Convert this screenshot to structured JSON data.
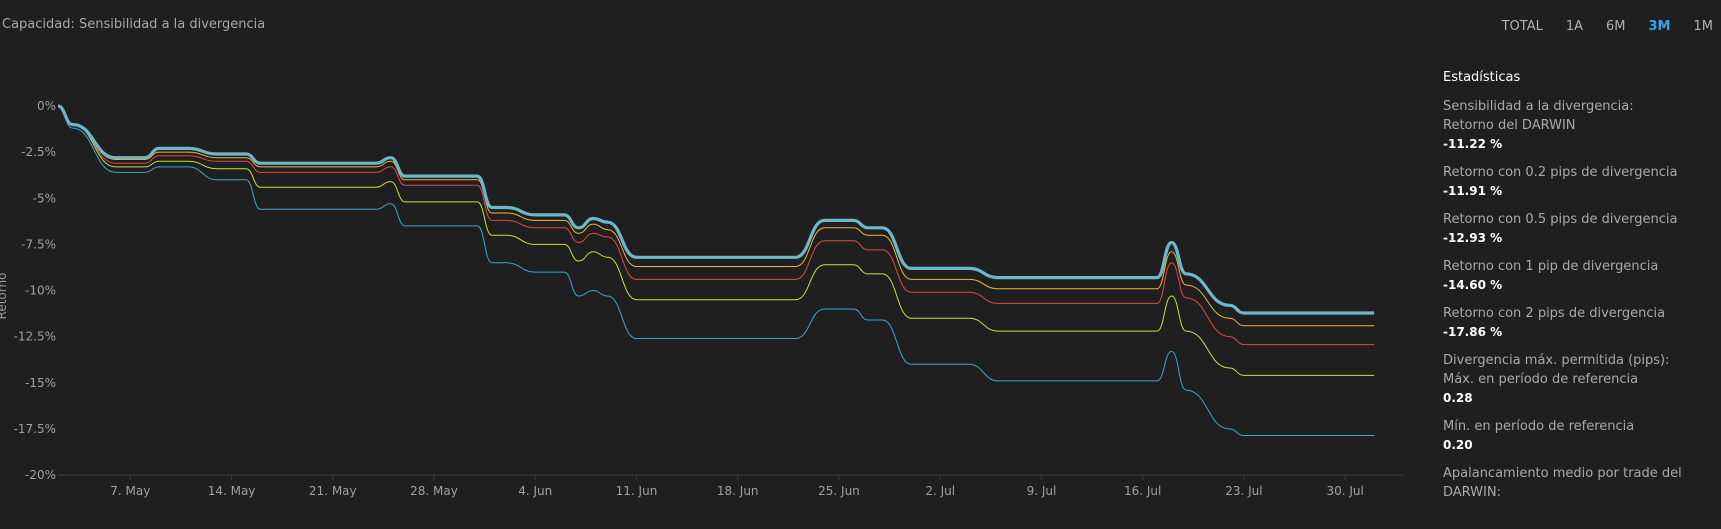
{
  "header": {
    "title": "Capacidad: Sensibilidad a la divergencia",
    "ranges": [
      "TOTAL",
      "1A",
      "6M",
      "3M",
      "1M"
    ],
    "active_range": "3M"
  },
  "stats": {
    "heading": "Estadísticas",
    "items": [
      {
        "label": "Sensibilidad a la divergencia:",
        "value": ""
      },
      {
        "label": "Retorno del DARWIN",
        "value": "-11.22 %"
      },
      {
        "label": "Retorno con 0.2 pips de divergencia",
        "value": "-11.91 %"
      },
      {
        "label": "Retorno con 0.5 pips de divergencia",
        "value": "-12.93 %"
      },
      {
        "label": "Retorno con 1 pip de divergencia",
        "value": "-14.60 %"
      },
      {
        "label": "Retorno con 2 pips de divergencia",
        "value": "-17.86 %"
      },
      {
        "label": "Divergencia máx. permitida (pips):",
        "value": ""
      },
      {
        "label": "Máx. en período de referencia",
        "value": "0.28"
      },
      {
        "label": "Mín. en período de referencia",
        "value": "0.20"
      },
      {
        "label": "Apalancamiento medio por trade del DARWIN:",
        "value": ""
      }
    ]
  },
  "chart_data": {
    "type": "line",
    "ylabel": "Retorno",
    "ylim": [
      -20,
      0
    ],
    "y_ticks": [
      {
        "value": 0,
        "label": "0%"
      },
      {
        "value": -2.5,
        "label": "-2.5%"
      },
      {
        "value": -5,
        "label": "-5%"
      },
      {
        "value": -7.5,
        "label": "-7.5%"
      },
      {
        "value": -10,
        "label": "-10%"
      },
      {
        "value": -12.5,
        "label": "-12.5%"
      },
      {
        "value": -15,
        "label": "-15%"
      },
      {
        "value": -17.5,
        "label": "-17.5%"
      },
      {
        "value": -20,
        "label": "-20%"
      }
    ],
    "x_ticks": [
      {
        "value": "2024-05-07",
        "label": "7. May"
      },
      {
        "value": "2024-05-14",
        "label": "14. May"
      },
      {
        "value": "2024-05-21",
        "label": "21. May"
      },
      {
        "value": "2024-05-28",
        "label": "28. May"
      },
      {
        "value": "2024-06-04",
        "label": "4. Jun"
      },
      {
        "value": "2024-06-11",
        "label": "11. Jun"
      },
      {
        "value": "2024-06-18",
        "label": "18. Jun"
      },
      {
        "value": "2024-06-25",
        "label": "25. Jun"
      },
      {
        "value": "2024-07-02",
        "label": "2. Jul"
      },
      {
        "value": "2024-07-09",
        "label": "9. Jul"
      },
      {
        "value": "2024-07-16",
        "label": "16. Jul"
      },
      {
        "value": "2024-07-23",
        "label": "23. Jul"
      },
      {
        "value": "2024-07-30",
        "label": "30. Jul"
      }
    ],
    "xlim": [
      "2024-05-02",
      "2024-08-03"
    ],
    "grid": false,
    "legend": "none",
    "series": [
      {
        "color": "#6cb8c9",
        "width": 3.2,
        "points": [
          [
            "2024-05-02",
            0
          ],
          [
            "2024-05-03",
            -1
          ],
          [
            "2024-05-06",
            -2.8
          ],
          [
            "2024-05-08",
            -2.8
          ],
          [
            "2024-05-09",
            -2.3
          ],
          [
            "2024-05-11",
            -2.3
          ],
          [
            "2024-05-13",
            -2.6
          ],
          [
            "2024-05-15",
            -2.6
          ],
          [
            "2024-05-16",
            -3.1
          ],
          [
            "2024-05-24",
            -3.1
          ],
          [
            "2024-05-25",
            -2.8
          ],
          [
            "2024-05-26",
            -3.8
          ],
          [
            "2024-05-31",
            -3.8
          ],
          [
            "2024-06-01",
            -5.5
          ],
          [
            "2024-06-02",
            -5.5
          ],
          [
            "2024-06-04",
            -5.9
          ],
          [
            "2024-06-06",
            -5.9
          ],
          [
            "2024-06-07",
            -6.6
          ],
          [
            "2024-06-08",
            -6.1
          ],
          [
            "2024-06-09",
            -6.3
          ],
          [
            "2024-06-11",
            -8.2
          ],
          [
            "2024-06-22",
            -8.2
          ],
          [
            "2024-06-24",
            -6.2
          ],
          [
            "2024-06-26",
            -6.2
          ],
          [
            "2024-06-27",
            -6.6
          ],
          [
            "2024-06-28",
            -6.6
          ],
          [
            "2024-06-30",
            -8.8
          ],
          [
            "2024-07-04",
            -8.8
          ],
          [
            "2024-07-06",
            -9.3
          ],
          [
            "2024-07-17",
            -9.3
          ],
          [
            "2024-07-18",
            -7.4
          ],
          [
            "2024-07-19",
            -9.1
          ],
          [
            "2024-07-22",
            -10.8
          ],
          [
            "2024-07-23",
            -11.22
          ],
          [
            "2024-08-01",
            -11.22
          ]
        ]
      },
      {
        "color": "#f0b43c",
        "width": 1,
        "points": [
          [
            "2024-05-02",
            0
          ],
          [
            "2024-05-03",
            -1
          ],
          [
            "2024-05-06",
            -2.9
          ],
          [
            "2024-05-08",
            -2.9
          ],
          [
            "2024-05-09",
            -2.5
          ],
          [
            "2024-05-11",
            -2.5
          ],
          [
            "2024-05-13",
            -2.8
          ],
          [
            "2024-05-15",
            -2.8
          ],
          [
            "2024-05-16",
            -3.3
          ],
          [
            "2024-05-24",
            -3.3
          ],
          [
            "2024-05-25",
            -3.0
          ],
          [
            "2024-05-26",
            -4.0
          ],
          [
            "2024-05-31",
            -4.0
          ],
          [
            "2024-06-01",
            -5.8
          ],
          [
            "2024-06-02",
            -5.8
          ],
          [
            "2024-06-04",
            -6.2
          ],
          [
            "2024-06-06",
            -6.2
          ],
          [
            "2024-06-07",
            -6.9
          ],
          [
            "2024-06-08",
            -6.4
          ],
          [
            "2024-06-09",
            -6.7
          ],
          [
            "2024-06-11",
            -8.7
          ],
          [
            "2024-06-22",
            -8.7
          ],
          [
            "2024-06-24",
            -6.6
          ],
          [
            "2024-06-26",
            -6.6
          ],
          [
            "2024-06-27",
            -7.0
          ],
          [
            "2024-06-28",
            -7.0
          ],
          [
            "2024-06-30",
            -9.4
          ],
          [
            "2024-07-04",
            -9.4
          ],
          [
            "2024-07-06",
            -9.9
          ],
          [
            "2024-07-17",
            -9.9
          ],
          [
            "2024-07-18",
            -7.9
          ],
          [
            "2024-07-19",
            -9.7
          ],
          [
            "2024-07-22",
            -11.5
          ],
          [
            "2024-07-23",
            -11.91
          ],
          [
            "2024-08-01",
            -11.91
          ]
        ]
      },
      {
        "color": "#e04848",
        "width": 1,
        "points": [
          [
            "2024-05-02",
            0
          ],
          [
            "2024-05-03",
            -1
          ],
          [
            "2024-05-06",
            -3.1
          ],
          [
            "2024-05-08",
            -3.1
          ],
          [
            "2024-05-09",
            -2.7
          ],
          [
            "2024-05-11",
            -2.7
          ],
          [
            "2024-05-13",
            -3.0
          ],
          [
            "2024-05-15",
            -3.0
          ],
          [
            "2024-05-16",
            -3.6
          ],
          [
            "2024-05-24",
            -3.6
          ],
          [
            "2024-05-25",
            -3.3
          ],
          [
            "2024-05-26",
            -4.3
          ],
          [
            "2024-05-31",
            -4.3
          ],
          [
            "2024-06-01",
            -6.2
          ],
          [
            "2024-06-02",
            -6.2
          ],
          [
            "2024-06-04",
            -6.6
          ],
          [
            "2024-06-06",
            -6.6
          ],
          [
            "2024-06-07",
            -7.4
          ],
          [
            "2024-06-08",
            -6.9
          ],
          [
            "2024-06-09",
            -7.1
          ],
          [
            "2024-06-11",
            -9.4
          ],
          [
            "2024-06-22",
            -9.4
          ],
          [
            "2024-06-24",
            -7.3
          ],
          [
            "2024-06-26",
            -7.3
          ],
          [
            "2024-06-27",
            -7.8
          ],
          [
            "2024-06-28",
            -7.8
          ],
          [
            "2024-06-30",
            -10.1
          ],
          [
            "2024-07-04",
            -10.1
          ],
          [
            "2024-07-06",
            -10.7
          ],
          [
            "2024-07-17",
            -10.7
          ],
          [
            "2024-07-18",
            -8.5
          ],
          [
            "2024-07-19",
            -10.4
          ],
          [
            "2024-07-22",
            -12.5
          ],
          [
            "2024-07-23",
            -12.93
          ],
          [
            "2024-08-01",
            -12.93
          ]
        ]
      },
      {
        "color": "#c8e03c",
        "width": 1,
        "points": [
          [
            "2024-05-02",
            0
          ],
          [
            "2024-05-03",
            -1
          ],
          [
            "2024-05-06",
            -3.3
          ],
          [
            "2024-05-08",
            -3.3
          ],
          [
            "2024-05-09",
            -3.0
          ],
          [
            "2024-05-11",
            -3.0
          ],
          [
            "2024-05-13",
            -3.4
          ],
          [
            "2024-05-15",
            -3.4
          ],
          [
            "2024-05-16",
            -4.4
          ],
          [
            "2024-05-24",
            -4.4
          ],
          [
            "2024-05-25",
            -4.1
          ],
          [
            "2024-05-26",
            -5.2
          ],
          [
            "2024-05-31",
            -5.2
          ],
          [
            "2024-06-01",
            -7.0
          ],
          [
            "2024-06-02",
            -7.0
          ],
          [
            "2024-06-04",
            -7.5
          ],
          [
            "2024-06-06",
            -7.5
          ],
          [
            "2024-06-07",
            -8.4
          ],
          [
            "2024-06-08",
            -7.9
          ],
          [
            "2024-06-09",
            -8.2
          ],
          [
            "2024-06-11",
            -10.5
          ],
          [
            "2024-06-22",
            -10.5
          ],
          [
            "2024-06-24",
            -8.6
          ],
          [
            "2024-06-26",
            -8.6
          ],
          [
            "2024-06-27",
            -9.1
          ],
          [
            "2024-06-28",
            -9.1
          ],
          [
            "2024-06-30",
            -11.5
          ],
          [
            "2024-07-04",
            -11.5
          ],
          [
            "2024-07-06",
            -12.2
          ],
          [
            "2024-07-17",
            -12.2
          ],
          [
            "2024-07-18",
            -10.3
          ],
          [
            "2024-07-19",
            -12.2
          ],
          [
            "2024-07-22",
            -14.2
          ],
          [
            "2024-07-23",
            -14.6
          ],
          [
            "2024-08-01",
            -14.6
          ]
        ]
      },
      {
        "color": "#3aa7cc",
        "width": 1,
        "points": [
          [
            "2024-05-02",
            0
          ],
          [
            "2024-05-03",
            -1.2
          ],
          [
            "2024-05-06",
            -3.6
          ],
          [
            "2024-05-08",
            -3.6
          ],
          [
            "2024-05-09",
            -3.3
          ],
          [
            "2024-05-11",
            -3.3
          ],
          [
            "2024-05-13",
            -4.0
          ],
          [
            "2024-05-15",
            -4.0
          ],
          [
            "2024-05-16",
            -5.6
          ],
          [
            "2024-05-24",
            -5.6
          ],
          [
            "2024-05-25",
            -5.3
          ],
          [
            "2024-05-26",
            -6.5
          ],
          [
            "2024-05-31",
            -6.5
          ],
          [
            "2024-06-01",
            -8.5
          ],
          [
            "2024-06-02",
            -8.5
          ],
          [
            "2024-06-04",
            -9.0
          ],
          [
            "2024-06-06",
            -9.0
          ],
          [
            "2024-06-07",
            -10.3
          ],
          [
            "2024-06-08",
            -10.0
          ],
          [
            "2024-06-09",
            -10.3
          ],
          [
            "2024-06-11",
            -12.6
          ],
          [
            "2024-06-22",
            -12.6
          ],
          [
            "2024-06-24",
            -11.0
          ],
          [
            "2024-06-26",
            -11.0
          ],
          [
            "2024-06-27",
            -11.6
          ],
          [
            "2024-06-28",
            -11.6
          ],
          [
            "2024-06-30",
            -14.0
          ],
          [
            "2024-07-04",
            -14.0
          ],
          [
            "2024-07-06",
            -14.9
          ],
          [
            "2024-07-17",
            -14.9
          ],
          [
            "2024-07-18",
            -13.3
          ],
          [
            "2024-07-19",
            -15.4
          ],
          [
            "2024-07-22",
            -17.5
          ],
          [
            "2024-07-23",
            -17.86
          ],
          [
            "2024-08-01",
            -17.86
          ]
        ]
      }
    ]
  }
}
